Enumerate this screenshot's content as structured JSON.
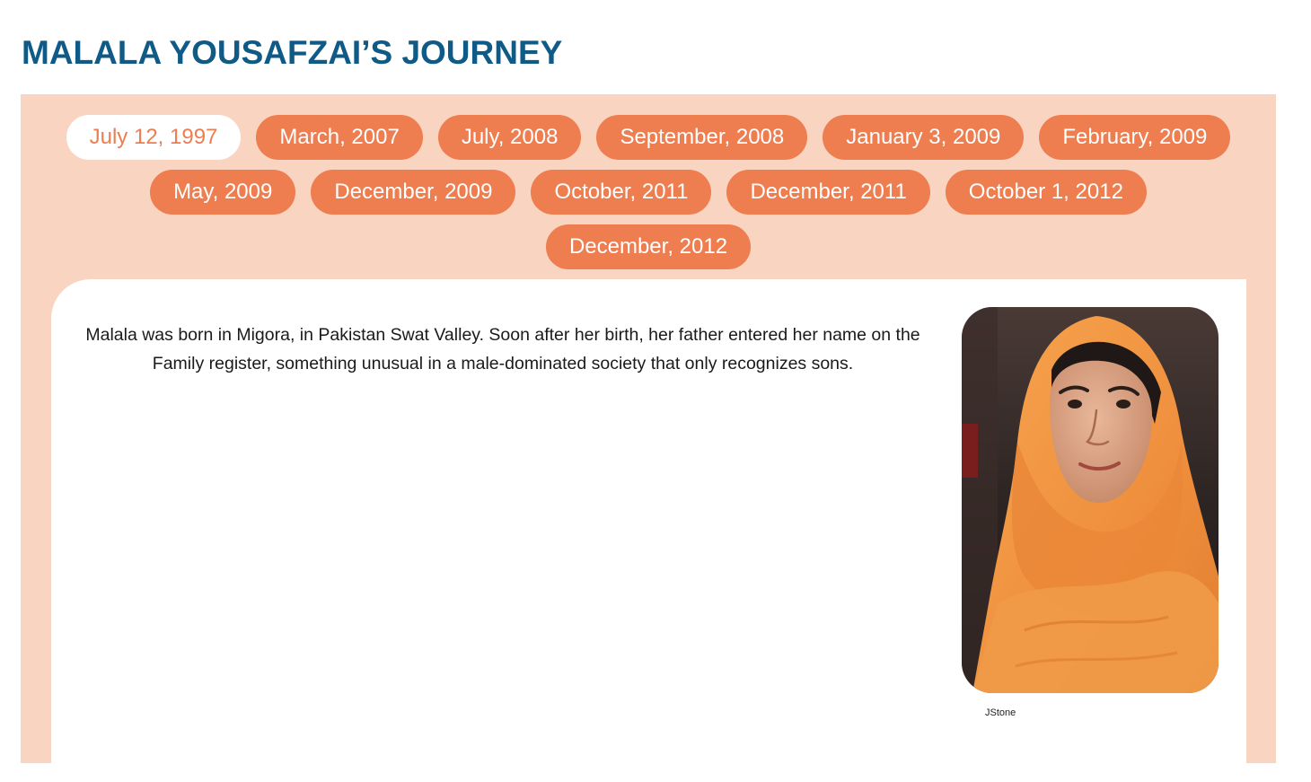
{
  "page": {
    "title": "MALALA YOUSAFZAI’S JOURNEY"
  },
  "timeline": {
    "active_index": 0,
    "tabs": [
      {
        "label": "July 12, 1997"
      },
      {
        "label": "March, 2007"
      },
      {
        "label": "July, 2008"
      },
      {
        "label": "September, 2008"
      },
      {
        "label": "January 3, 2009"
      },
      {
        "label": "February, 2009"
      },
      {
        "label": "May, 2009"
      },
      {
        "label": "December, 2009"
      },
      {
        "label": "October, 2011"
      },
      {
        "label": "December, 2011"
      },
      {
        "label": "October 1, 2012"
      },
      {
        "label": "December, 2012"
      }
    ]
  },
  "content": {
    "description": "Malala was born in Migora, in Pakistan Swat Valley. Soon after her birth, her father entered her name on the Family register, something unusual in a male-dominated society that only recognizes sons.",
    "photo_caption": "JStone"
  },
  "colors": {
    "title": "#0f5a86",
    "panel_background": "#f9d4c0",
    "tab_background": "#ee7d4f",
    "tab_text": "#ffffff",
    "active_tab_background": "#ffffff",
    "active_tab_text": "#ee7d4f",
    "scarf": "#f0913f"
  }
}
